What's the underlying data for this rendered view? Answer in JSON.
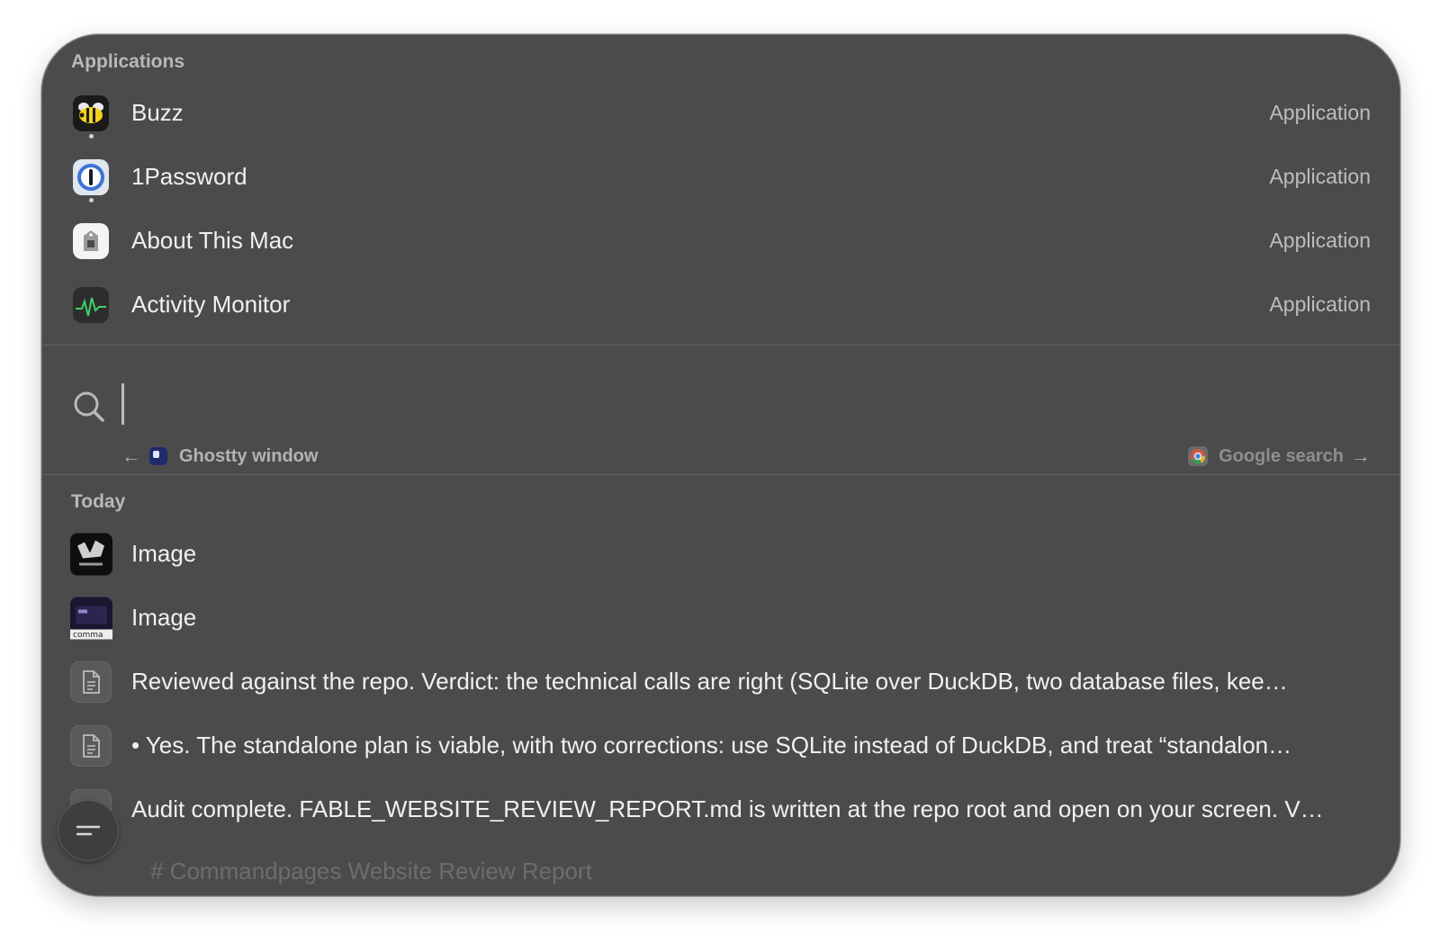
{
  "applications": {
    "header": "Applications",
    "items": [
      {
        "name": "Buzz",
        "kind": "Application",
        "icon": "bee-icon",
        "running": true
      },
      {
        "name": "1Password",
        "kind": "Application",
        "icon": "keyhole-icon",
        "running": true
      },
      {
        "name": "About This Mac",
        "kind": "Application",
        "icon": "mac-icon",
        "running": false
      },
      {
        "name": "Activity Monitor",
        "kind": "Application",
        "icon": "heartbeat-icon",
        "running": false
      }
    ]
  },
  "search": {
    "value": "",
    "placeholder": "",
    "back_label": "Ghostty window",
    "forward_label": "Google search"
  },
  "today": {
    "header": "Today",
    "items": [
      {
        "text": "Image",
        "icon": "image-thumbnail"
      },
      {
        "text": "Image",
        "icon": "image-thumbnail",
        "thumb_caption": "comma"
      },
      {
        "text": "Reviewed against the repo. Verdict: the technical calls are right (SQLite over DuckDB, two database files, kee…",
        "icon": "document-icon"
      },
      {
        "text": "• Yes. The standalone plan is viable, with two corrections: use SQLite instead of DuckDB, and treat “standalon…",
        "icon": "document-icon"
      },
      {
        "text": "Audit complete. FABLE_WEBSITE_REVIEW_REPORT.md is written at the repo root and open on your screen. V…",
        "icon": "document-icon"
      }
    ],
    "partial_item": "# Commandpages Website Review Report"
  },
  "colors": {
    "panel": "#4b4b4b",
    "text": "#f0f0f0",
    "muted": "#bdbdbd"
  }
}
